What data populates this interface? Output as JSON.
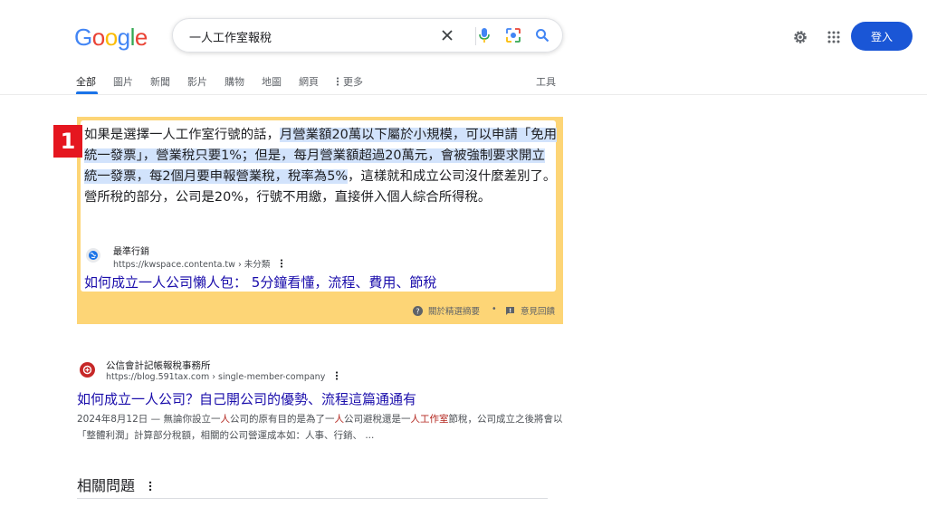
{
  "header": {
    "logo_letters": [
      {
        "ch": "G",
        "color": "#4285F4"
      },
      {
        "ch": "o",
        "color": "#EA4335"
      },
      {
        "ch": "o",
        "color": "#FBBC05"
      },
      {
        "ch": "g",
        "color": "#4285F4"
      },
      {
        "ch": "l",
        "color": "#34A853"
      },
      {
        "ch": "e",
        "color": "#EA4335"
      }
    ],
    "query": "一人工作室報稅",
    "login_label": "登入",
    "icons": [
      "clear-icon",
      "microphone-icon",
      "lens-icon",
      "search-icon",
      "settings-icon",
      "apps-icon"
    ]
  },
  "tabs": {
    "items": [
      "全部",
      "圖片",
      "新聞",
      "影片",
      "購物",
      "地圖",
      "網頁"
    ],
    "more_label": "更多",
    "tools_label": "工具"
  },
  "featured": {
    "badge": "1",
    "text_parts": [
      {
        "t": "如果是選擇一人工作室行號的話，",
        "hl": false
      },
      {
        "t": "月營業額20萬以下屬於小規模，可以申請「免用統一發票」，營業稅只要1%；但是，每月營業額超過20萬元，會被強制要求開立統一發票，每2個月要申報營業稅，稅率為5%",
        "hl": true
      },
      {
        "t": "，這樣就和成立公司沒什麼差別了。 營所稅的部分，公司是20%，行號不用繳，直接併入個人綜合所得稅。",
        "hl": false
      }
    ],
    "source_name": "最準行銷",
    "source_url": "https://kwspace.contenta.tw › 未分類",
    "link_title": "如何成立一人公司懶人包： 5分鐘看懂，流程、費用、節稅",
    "about_label": "關於精選摘要",
    "separator": "•",
    "feedback_label": "意見回饋",
    "highlight_color": "#fdd576"
  },
  "result2": {
    "site_name": "公信會計記帳報稅事務所",
    "url": "https://blog.591tax.com › single-member-company",
    "title": "如何成立一人公司？自己開公司的優勢、流程這篇通通有",
    "desc_parts": [
      {
        "t": "2024年8月12日 — 無論你設立一",
        "em": false
      },
      {
        "t": "人",
        "em": true
      },
      {
        "t": "公司的原有目的是為了一",
        "em": false
      },
      {
        "t": "人",
        "em": true
      },
      {
        "t": "公司避稅還是一",
        "em": false
      },
      {
        "t": "人工作室",
        "em": true
      },
      {
        "t": "節稅，公司成立之後將會以「整體利潤」計算部分稅額，相關的公司營運成本如：人事、行銷、 ...",
        "em": false
      }
    ]
  },
  "related": {
    "heading": "相關問題"
  }
}
